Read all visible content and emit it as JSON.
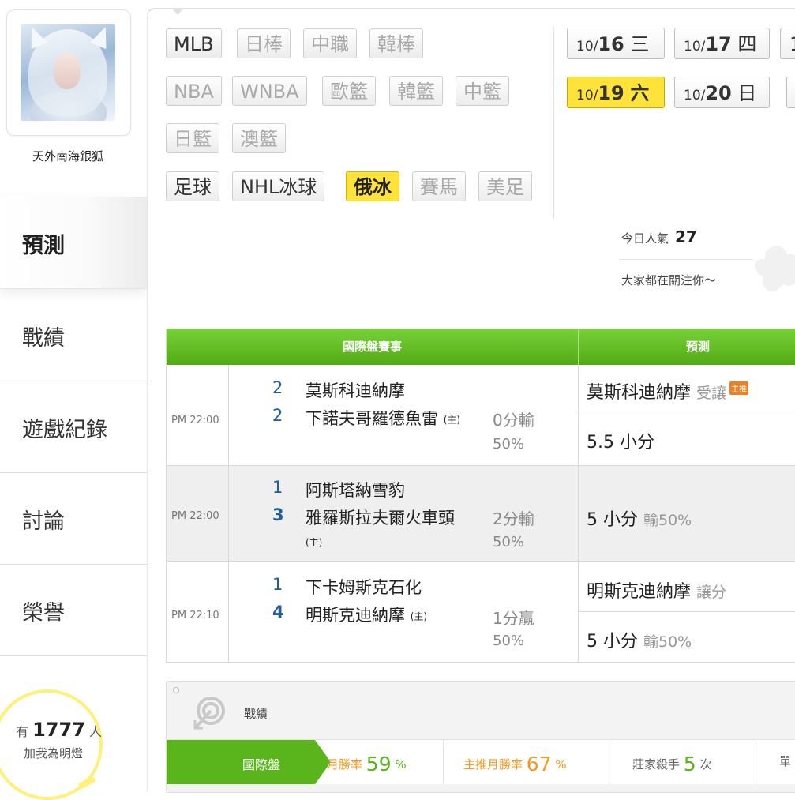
{
  "sidebar": {
    "username": "天外南海銀狐",
    "nav": [
      {
        "label": "預測",
        "active": true
      },
      {
        "label": "戰績",
        "active": false
      },
      {
        "label": "遊戲紀錄",
        "active": false
      },
      {
        "label": "討論",
        "active": false
      },
      {
        "label": "榮譽",
        "active": false
      }
    ],
    "fans": {
      "prefix": "有",
      "count": "1777",
      "suffix": "人",
      "line2": "加我為明燈"
    }
  },
  "sports": {
    "row1": [
      "MLB",
      "日棒",
      "中職",
      "韓棒"
    ],
    "row2": [
      "NBA",
      "WNBA",
      "歐籃",
      "韓籃",
      "中籃"
    ],
    "row3": [
      "日籃",
      "澳籃"
    ],
    "row4": [
      "足球",
      "NHL冰球",
      "俄冰",
      "賽馬",
      "美足"
    ],
    "selected": "俄冰"
  },
  "dates": [
    {
      "md": "10/",
      "d": "16",
      "w": "三"
    },
    {
      "md": "10/",
      "d": "17",
      "w": "四"
    },
    {
      "md": "",
      "d": "1",
      "w": ""
    },
    {
      "md": "10/",
      "d": "19",
      "w": "六",
      "selected": true
    },
    {
      "md": "10/",
      "d": "20",
      "w": "日"
    }
  ],
  "popularity": {
    "label": "今日人氣",
    "value": "27",
    "subtitle": "大家都在關注你～"
  },
  "table": {
    "header_left": "國際盤賽事",
    "header_right": "預測",
    "games": [
      {
        "time": "PM 22:00",
        "away_score": "2",
        "away_team": "莫斯科迪納摩",
        "home_score": "2",
        "home_team": "下諾夫哥羅德魚雷",
        "home_mark": "(主)",
        "line": "0分輸",
        "line_pct": "50%",
        "pred1": "莫斯科迪納摩",
        "pred1_note": "受讓",
        "pred1_badge": "主推",
        "pred2": "5.5 小分",
        "pred2_note": ""
      },
      {
        "time": "PM 22:00",
        "away_score": "1",
        "away_team": "阿斯塔納雪豹",
        "home_score": "3",
        "home_team": "雅羅斯拉夫爾火車頭",
        "home_mark": "(主)",
        "line": "2分輸",
        "line_pct": "50%",
        "pred1": "5 小分",
        "pred1_note": "輸50%"
      },
      {
        "time": "PM 22:10",
        "away_score": "1",
        "away_team": "下卡姆斯克石化",
        "home_score": "4",
        "home_team": "明斯克迪納摩",
        "home_mark": "(主)",
        "line": "1分贏",
        "line_pct": "50%",
        "pred1": "明斯克迪納摩",
        "pred1_note": "讓分",
        "pred2": "5 小分",
        "pred2_note": "輸50%"
      }
    ]
  },
  "record": {
    "title": "戰績",
    "tab": "國際盤",
    "monthly_label": "月勝率",
    "monthly_value": "59",
    "monthly_unit": "%",
    "featured_label": "主推月勝率",
    "featured_value": "67",
    "featured_unit": "%",
    "killer_label": "莊家殺手",
    "killer_value": "5",
    "killer_unit": "次",
    "cut_label": "單",
    "colors": {
      "green": "#5ab51c",
      "orange": "#f39a1e"
    }
  }
}
